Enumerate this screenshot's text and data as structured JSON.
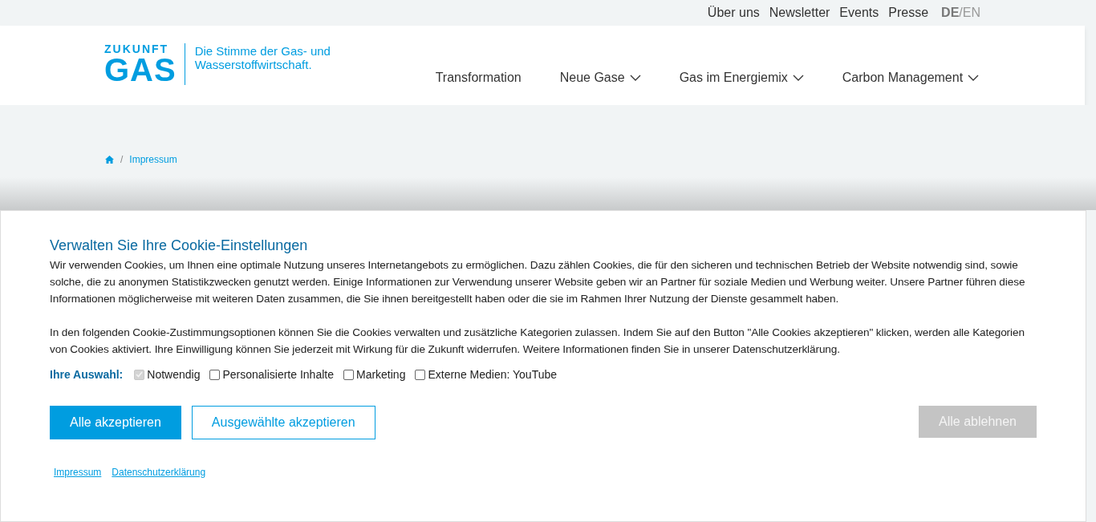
{
  "top_links": [
    "Über uns",
    "Newsletter",
    "Events",
    "Presse"
  ],
  "language_separator": "/",
  "languages": [
    {
      "label": "DE",
      "selected": true
    },
    {
      "label": "EN",
      "selected": false
    }
  ],
  "logo": {
    "top": "ZUKUNFT",
    "main": "GAS",
    "tagline": "Die Stimme der Gas- und Wasserstoffwirtschaft."
  },
  "main_nav": [
    {
      "label": "Transformation",
      "has_menu": false
    },
    {
      "label": "Neue Gase",
      "has_menu": true
    },
    {
      "label": "Gas im Energiemix",
      "has_menu": true
    },
    {
      "label": "Carbon Management",
      "has_menu": true
    }
  ],
  "breadcrumb": [
    {
      "separator": "/",
      "label": "Impressum"
    }
  ],
  "cookie_dialog": {
    "title": "Verwalten Sie Ihre Cookie-Einstellungen",
    "paragraphs": [
      "Wir verwenden Cookies, um Ihnen eine optimale Nutzung unseres Internetangebots zu ermöglichen. Dazu zählen Cookies, die für den sicheren und technischen Betrieb der Website notwendig sind, sowie solche, die zu anonymen Statistikzwecken genutzt werden. Einige Informationen zur Verwendung unserer Website geben wir an Partner für soziale Medien und Werbung weiter. Unsere Partner führen diese Informationen möglicherweise mit weiteren Daten zusammen, die Sie ihnen bereitgestellt haben oder die sie im Rahmen Ihrer Nutzung der Dienste gesammelt haben.",
      "In den folgenden Cookie-Zustimmungsoptionen können Sie die Cookies verwalten und zusätzliche Kategorien zulassen. Indem Sie auf den Button \"Alle Cookies akzeptieren\" klicken, werden alle Kategorien von Cookies aktiviert. Ihre Einwilligung können Sie jederzeit mit Wirkung für die Zukunft widerrufen. Weitere Informationen finden Sie in unserer Datenschutzerklärung."
    ],
    "choice_label": "Ihre Auswahl:",
    "options": [
      {
        "label": "Notwendig",
        "checked": true,
        "disabled": true
      },
      {
        "label": "Personalisierte Inhalte",
        "checked": false,
        "disabled": false
      },
      {
        "label": "Marketing",
        "checked": false,
        "disabled": false
      },
      {
        "label": "Externe Medien: YouTube",
        "checked": false,
        "disabled": false
      }
    ],
    "buttons": [
      {
        "label": "Alle akzeptieren",
        "kind": "primary"
      },
      {
        "label": "Ausgewählte akzeptieren",
        "kind": "outline"
      },
      {
        "label": "Alle ablehnen",
        "kind": "muted"
      }
    ],
    "links": [
      "Impressum",
      "Datenschutzerklärung"
    ]
  }
}
